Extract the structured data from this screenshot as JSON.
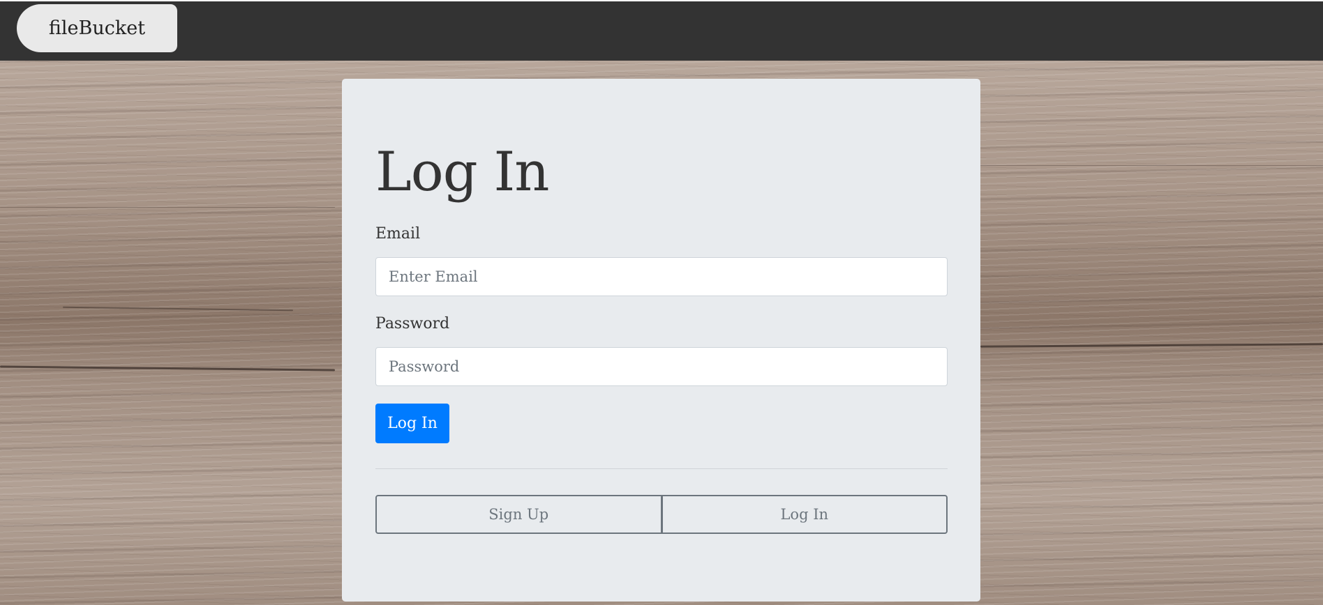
{
  "navbar": {
    "brand": "fileBucket"
  },
  "login_card": {
    "title": "Log In",
    "email": {
      "label": "Email",
      "placeholder": "Enter Email",
      "value": ""
    },
    "password": {
      "label": "Password",
      "placeholder": "Password",
      "value": ""
    },
    "submit_label": "Log In",
    "switcher": {
      "signup_label": "Sign Up",
      "login_label": "Log In"
    }
  },
  "colors": {
    "navbar_bg": "#333333",
    "brand_bg": "#e9e9e9",
    "card_bg": "#e8ebee",
    "primary": "#007bff",
    "secondary": "#6c757d"
  }
}
